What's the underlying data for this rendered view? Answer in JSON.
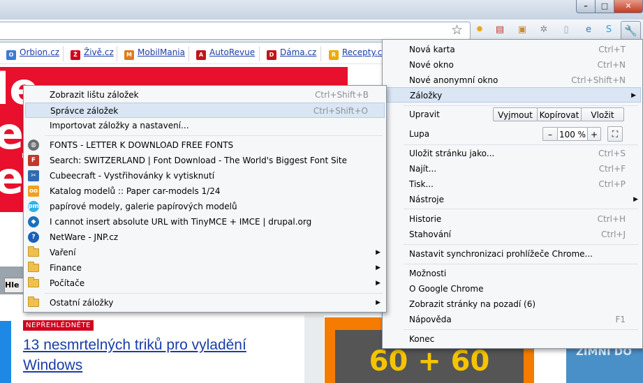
{
  "window": {
    "min": "–",
    "max": "□",
    "close": "✕"
  },
  "toolbar": {
    "star": "☆",
    "extensions": [
      {
        "name": "sun-extension-icon",
        "glyph": "✹",
        "color": "#e8a317"
      },
      {
        "name": "tabs-extension-icon",
        "glyph": "▤",
        "color": "#c0392b"
      },
      {
        "name": "box-extension-icon",
        "glyph": "▣",
        "color": "#c68a3a"
      },
      {
        "name": "gear-extension-icon",
        "glyph": "✲",
        "color": "#888"
      },
      {
        "name": "page-extension-icon",
        "glyph": "▯",
        "color": "#9aa"
      },
      {
        "name": "ie-tab-extension-icon",
        "glyph": "e",
        "color": "#2a7cc7"
      },
      {
        "name": "skype-extension-icon",
        "glyph": "S",
        "color": "#2aa0e0"
      }
    ],
    "wrench": "🔧"
  },
  "bookmark_bar": [
    {
      "label": "Orbion.cz",
      "fav_color": "#3a7bd5",
      "fav": "O"
    },
    {
      "label": "Živě.cz",
      "fav_color": "#d0021b",
      "fav": "Ž"
    },
    {
      "label": "MobilMania",
      "fav_color": "#e07b1b",
      "fav": "M"
    },
    {
      "label": "AutoRevue",
      "fav_color": "#c0151b",
      "fav": "A"
    },
    {
      "label": "Dáma.cz",
      "fav_color": "#c0151b",
      "fav": "D"
    },
    {
      "label": "Recepty.cz",
      "fav_color": "#f2a900",
      "fav": "R"
    }
  ],
  "page": {
    "banner_text": "le ej es",
    "search_button": "Hle",
    "badge": "NEPŘEHLÉDNĚTE",
    "headline": "13 nesmrtelných triků pro vyladění Windows",
    "promo": "60 + 60",
    "right_text": "ZIMNÍ DO"
  },
  "chrome_menu": {
    "new_tab": {
      "label": "Nová karta",
      "shortcut": "Ctrl+T"
    },
    "new_window": {
      "label": "Nové okno",
      "shortcut": "Ctrl+N"
    },
    "new_incognito": {
      "label": "Nové anonymní okno",
      "shortcut": "Ctrl+Shift+N"
    },
    "bookmarks": {
      "label": "Záložky",
      "arrow": "▶"
    },
    "edit": {
      "label": "Upravit",
      "cut": "Vyjmout",
      "copy": "Kopírovat",
      "paste": "Vložit"
    },
    "zoom": {
      "label": "Lupa",
      "minus": "–",
      "value": "100 %",
      "plus": "+",
      "fullscreen": "⛶"
    },
    "save_page": {
      "label": "Uložit stránku jako...",
      "shortcut": "Ctrl+S"
    },
    "find": {
      "label": "Najít...",
      "shortcut": "Ctrl+F"
    },
    "print": {
      "label": "Tisk...",
      "shortcut": "Ctrl+P"
    },
    "tools": {
      "label": "Nástroje",
      "arrow": "▶"
    },
    "history": {
      "label": "Historie",
      "shortcut": "Ctrl+H"
    },
    "downloads": {
      "label": "Stahování",
      "shortcut": "Ctrl+J"
    },
    "sync": {
      "label": "Nastavit synchronizaci prohlížeče Chrome..."
    },
    "options": {
      "label": "Možnosti"
    },
    "about": {
      "label": "O  Google Chrome"
    },
    "background_pages": {
      "label": "Zobrazit stránky na pozadí (6)"
    },
    "help": {
      "label": "Nápověda",
      "shortcut": "F1"
    },
    "exit": {
      "label": "Konec"
    }
  },
  "bookmarks_menu": {
    "show_bar": {
      "label": "Zobrazit lištu záložek",
      "shortcut": "Ctrl+Shift+B"
    },
    "manager": {
      "label": "Správce záložek",
      "shortcut": "Ctrl+Shift+O"
    },
    "import": {
      "label": "Importovat záložky a nastavení..."
    },
    "items": [
      {
        "label": "FONTS - LETTER K DOWNLOAD FREE FONTS",
        "icon": "globe-icon",
        "color": "#6b6f74",
        "glyph": "◍"
      },
      {
        "label": "Search: SWITZERLAND |  Font Download - The World's Biggest Font Site",
        "icon": "font-site-icon",
        "color": "#c0392b",
        "glyph": "F"
      },
      {
        "label": "Cubeecraft - Vystřihovánky k vytisknutí",
        "icon": "scissors-icon",
        "color": "#2d6cb5",
        "glyph": "✂"
      },
      {
        "label": "Katalog modelů :: Paper car-models 1/24",
        "icon": "owl-icon",
        "color": "#f0a020",
        "glyph": "oo"
      },
      {
        "label": "papírové modely, galerie papírových modelů",
        "icon": "pm-icon",
        "color": "#2db3e8",
        "glyph": "pm"
      },
      {
        "label": "I cannot insert absolute URL with TinyMCE + IMCE | drupal.org",
        "icon": "drupal-icon",
        "color": "#1b6fb8",
        "glyph": "◆"
      },
      {
        "label": "NetWare - JNP.cz",
        "icon": "help-icon",
        "color": "#1b5fb8",
        "glyph": "?"
      }
    ],
    "folders": [
      {
        "label": "Vaření",
        "arrow": "▶"
      },
      {
        "label": "Finance",
        "arrow": "▶"
      },
      {
        "label": "Počítače",
        "arrow": "▶"
      }
    ],
    "other": {
      "label": "Ostatní záložky",
      "arrow": "▶"
    }
  }
}
